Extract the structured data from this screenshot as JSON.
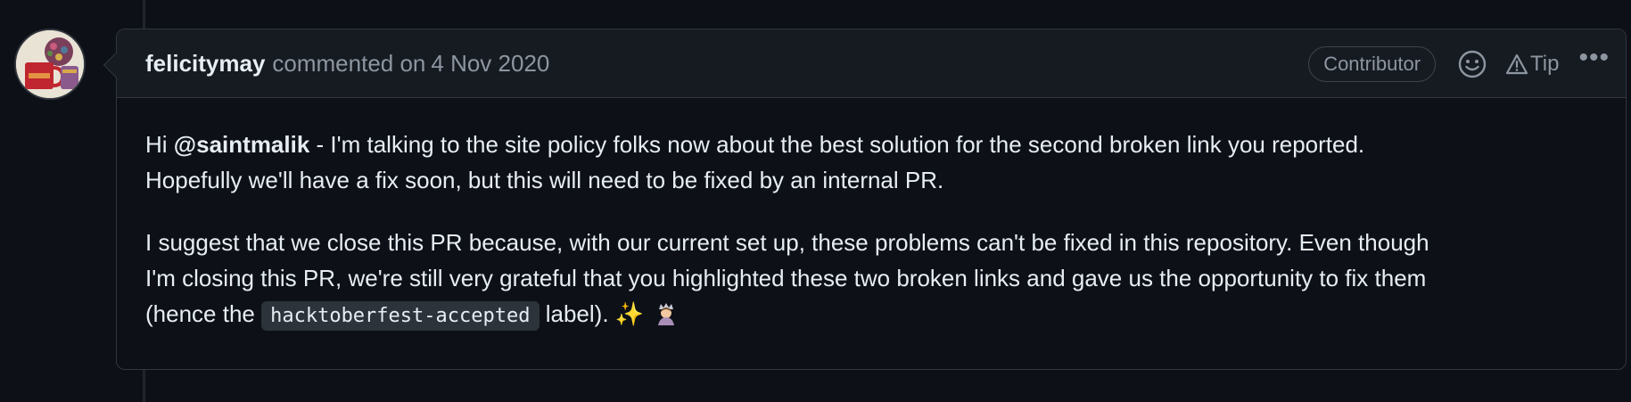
{
  "comment": {
    "author": "felicitymay",
    "action": "commented on",
    "date": "4 Nov 2020",
    "badge": "Contributor",
    "tip_label": "Tip",
    "more_label": "•••",
    "paragraph1": {
      "prefix": "Hi ",
      "mention": "@saintmalik",
      "line1_rest": " - I'm talking to the site policy folks now about the best solution for the second broken link you reported.",
      "line2": "Hopefully we'll have a fix soon, but this will need to be fixed by an internal PR."
    },
    "paragraph2": {
      "line1": "I suggest that we close this PR because, with our current set up, these problems can't be fixed in this repository. Even though",
      "line2": "I'm closing this PR, we're still very grateful that you highlighted these two broken links and gave us the opportunity to fix them",
      "line3_prefix": "(hence the ",
      "label_code": "hacktoberfest-accepted",
      "line3_suffix": " label). ",
      "sparkles": "✨"
    }
  },
  "icons": {
    "avatar": "avatar-mug-teapot",
    "reaction": "smiley-icon",
    "tip": "triangle-alert-icon",
    "more": "kebab-horizontal-icon",
    "emoji": "person-emoji-icon"
  }
}
